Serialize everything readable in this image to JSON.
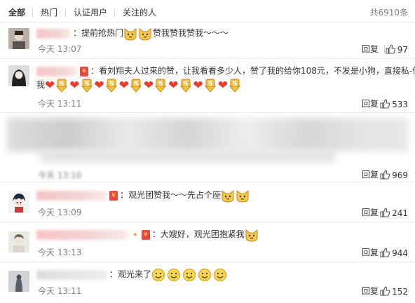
{
  "filters": {
    "tabs": [
      "全部",
      "热门",
      "认证用户",
      "关注的人"
    ],
    "total": "共6910条"
  },
  "actions": {
    "reply": "回复"
  },
  "icons": {
    "thumb": "thumbs-up-icon",
    "cat": "cat-emoji-icon",
    "heart": "heart-emoji-icon",
    "five": "number-five-emoji-icon",
    "smile": "smile-emoji-icon",
    "redpacket": "red-packet-badge-icon"
  },
  "colors": {
    "heart": "#e83c2f",
    "badge": "#e84a3f",
    "muted": "#808080"
  },
  "comments": [
    {
      "text": "：提前抢热门",
      "text2": "赞我赞我赞我～～～",
      "time": "今天 13:07",
      "likes": "97"
    },
    {
      "text": "：看刘翔夫人过来的赞，让我看看多少人，赞了我的给你108元，不发是小狗，直接私-信",
      "text2": "我",
      "time": "今天 13:11",
      "likes": "533"
    },
    {
      "text": "",
      "time": "今天 13:10",
      "likes": "969"
    },
    {
      "text": "：观光团赞我～～先占个座",
      "time": "今天 13:09",
      "likes": "241"
    },
    {
      "text": "：大嫂好，观光团抱紧我",
      "time": "今天 13:13",
      "likes": "944"
    },
    {
      "text": "：观光来了",
      "time": "今天 13:11",
      "likes": "152"
    }
  ]
}
